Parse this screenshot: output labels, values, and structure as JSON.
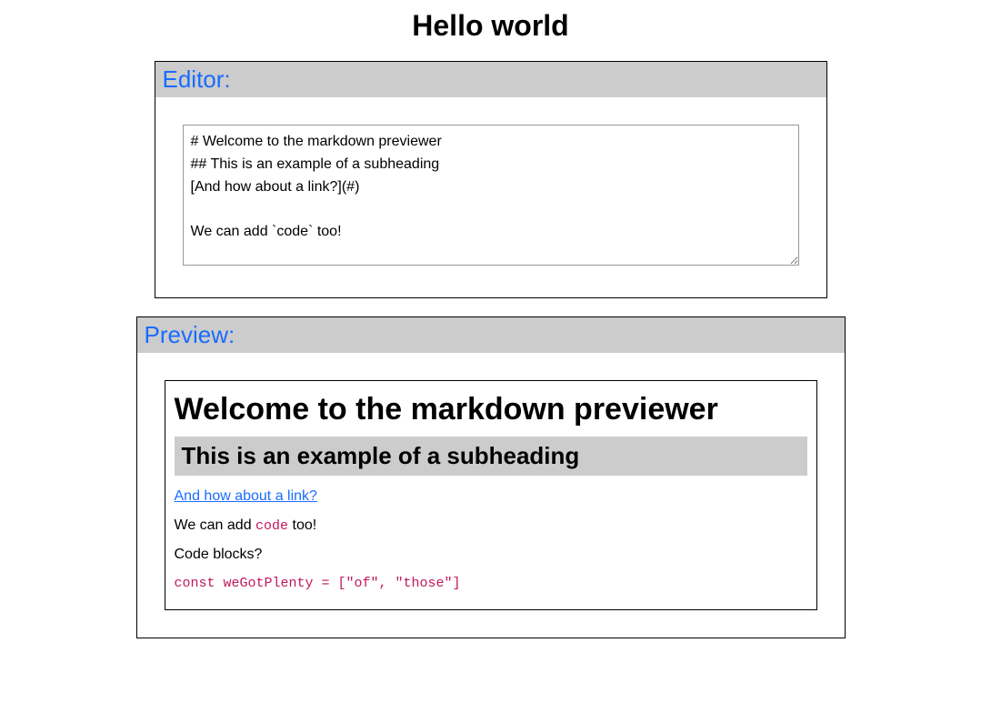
{
  "page": {
    "title": "Hello world"
  },
  "editor": {
    "header": "Editor:",
    "content": "# Welcome to the markdown previewer\n## This is an example of a subheading\n[And how about a link?](#)\n\nWe can add `code` too!"
  },
  "preview": {
    "header": "Preview:",
    "h1": "Welcome to the markdown previewer",
    "h2": "This is an example of a subheading",
    "link_text": "And how about a link?",
    "link_href": "#",
    "p1_pre": "We can add ",
    "p1_code": "code",
    "p1_post": " too!",
    "p2": "Code blocks?",
    "codeblock": "const weGotPlenty = [\"of\", \"those\"]"
  }
}
